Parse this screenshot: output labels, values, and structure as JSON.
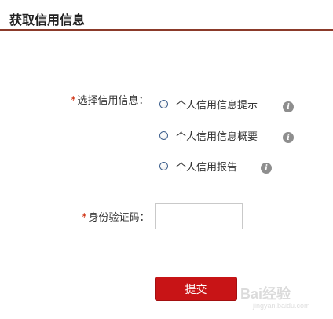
{
  "header": {
    "title": "获取信用信息"
  },
  "form": {
    "required_mark": "*",
    "credit_label": "选择信用信息：",
    "options": [
      {
        "label": "个人信用信息提示",
        "selected": false
      },
      {
        "label": "个人信用信息概要",
        "selected": false
      },
      {
        "label": "个人信用报告",
        "selected": false
      }
    ],
    "info_icon_glyph": "i",
    "code_label": "身份验证码：",
    "code_value": "",
    "submit_label": "提交"
  },
  "watermark": {
    "brand": "Bai",
    "brand2": "经验",
    "sub": "jingyan.baidu.com"
  },
  "colors": {
    "accent": "#c81416",
    "rule": "#8b3a2a",
    "required": "#cc2200"
  }
}
